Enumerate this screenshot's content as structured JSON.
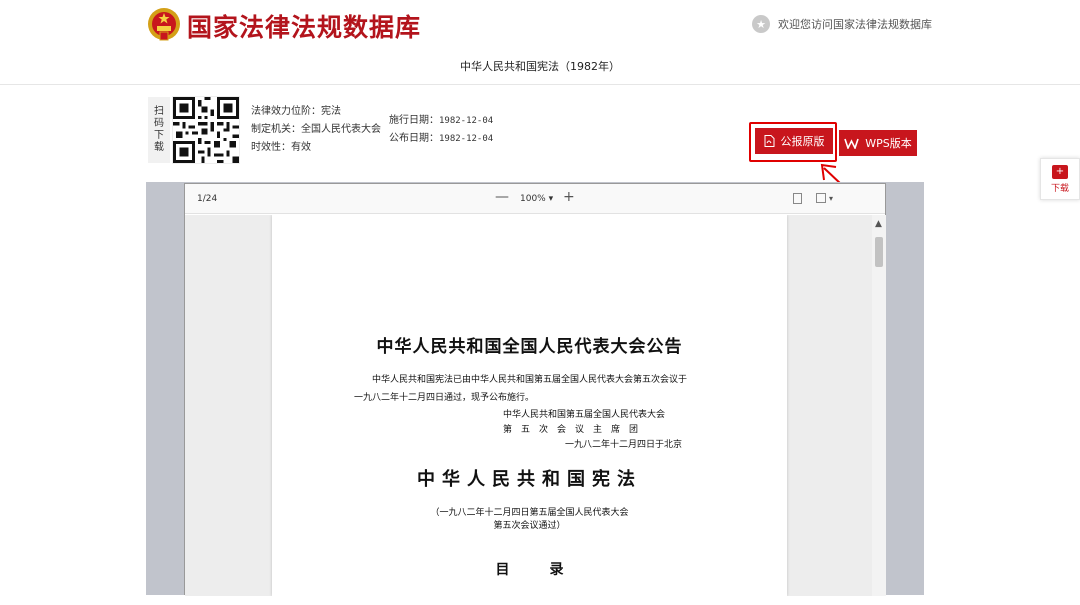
{
  "header": {
    "site_title": "国家法律法规数据库",
    "welcome_text": "欢迎您访问国家法律法规数据库"
  },
  "document_title": "中华人民共和国宪法（1982年）",
  "qr_side_label": [
    "扫",
    "码",
    "下",
    "载"
  ],
  "meta_left": [
    {
      "label": "法律效力位阶：",
      "value": "宪法"
    },
    {
      "label": "制定机关：",
      "value": "全国人民代表大会"
    },
    {
      "label": "时效性：",
      "value": "有效"
    }
  ],
  "meta_right": [
    {
      "label": "施行日期：",
      "value": "1982-12-04"
    },
    {
      "label": "公布日期：",
      "value": "1982-12-04"
    }
  ],
  "buttons": {
    "gazette_label": "公报原版",
    "wps_label": "WPS版本",
    "download_label": "下载"
  },
  "viewer": {
    "page_count": "1/24",
    "zoom_level": "100%",
    "zoom_caret": "▾",
    "minus": "—",
    "plus": "+"
  },
  "page": {
    "announcement_title": "中华人民共和国全国人民代表大会公告",
    "para_line1": "中华人民共和国宪法已由中华人民共和国第五届全国人民代表大会第五次会议于",
    "para_line2": "一九八二年十二月四日通过，现予公布施行。",
    "sign1": "中华人民共和国第五届全国人民代表大会",
    "sign2": "第　五　次　会　议　主　席　团",
    "sign3": "一九八二年十二月四日于北京",
    "constitution_title": "中华人民共和国宪法",
    "adopted_line1": "（一九八二年十二月四日第五届全国人民代表大会",
    "adopted_line2": "第五次会议通过）",
    "toc": "目录"
  },
  "colors": {
    "brand_red": "#b3141c",
    "button_red": "#c8161d",
    "highlight": "#e00000"
  }
}
